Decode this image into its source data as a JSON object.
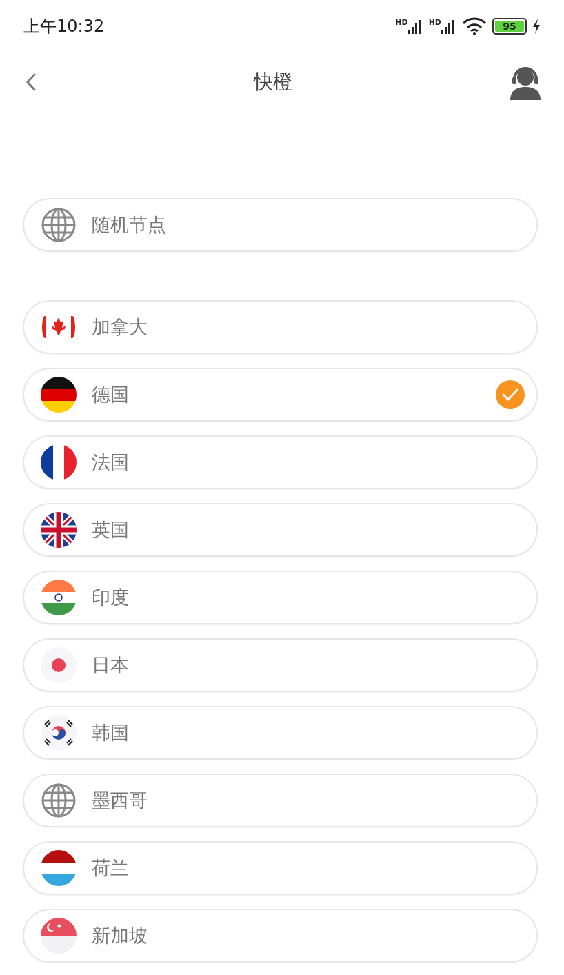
{
  "status_bar": {
    "time": "上午10:32",
    "signal_labels": [
      "HD",
      "HD"
    ],
    "battery": "95"
  },
  "header": {
    "title": "快橙"
  },
  "random_node": {
    "label": "随机节点"
  },
  "countries": [
    {
      "name": "加拿大",
      "kind": "canada",
      "selected": false
    },
    {
      "name": "德国",
      "kind": "germany",
      "selected": true
    },
    {
      "name": "法国",
      "kind": "france",
      "selected": false
    },
    {
      "name": "英国",
      "kind": "uk",
      "selected": false
    },
    {
      "name": "印度",
      "kind": "india",
      "selected": false
    },
    {
      "name": "日本",
      "kind": "japan",
      "selected": false
    },
    {
      "name": "韩国",
      "kind": "korea",
      "selected": false
    },
    {
      "name": "墨西哥",
      "kind": "globe",
      "selected": false
    },
    {
      "name": "荷兰",
      "kind": "netherlands",
      "selected": false
    },
    {
      "name": "新加坡",
      "kind": "singapore",
      "selected": false
    }
  ]
}
